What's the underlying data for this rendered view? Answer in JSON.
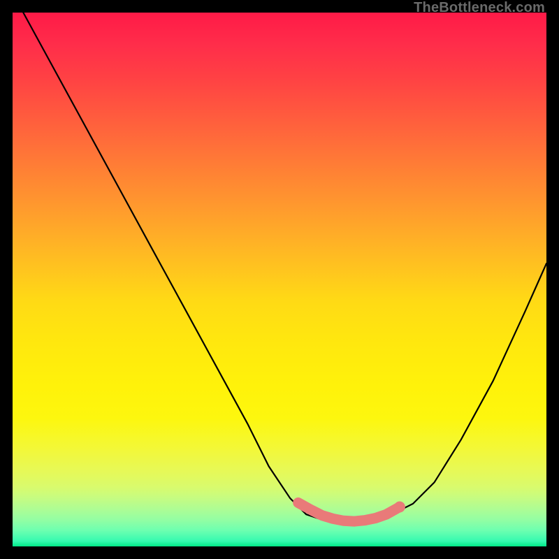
{
  "watermark": "TheBottleneck.com",
  "chart_data": {
    "type": "line",
    "title": "",
    "xlabel": "",
    "ylabel": "",
    "xlim": [
      0,
      100
    ],
    "ylim": [
      0,
      100
    ],
    "series": [
      {
        "name": "bottleneck-curve",
        "x": [
          2,
          8,
          14,
          20,
          26,
          32,
          38,
          44,
          48,
          52,
          55,
          58,
          62,
          65,
          68,
          71,
          75,
          79,
          84,
          90,
          96,
          100
        ],
        "y": [
          100,
          89,
          78,
          67,
          56,
          45,
          34,
          23,
          15,
          9,
          6,
          5,
          4.5,
          4.5,
          5,
          6,
          8,
          12,
          20,
          31,
          44,
          53
        ]
      }
    ],
    "highlight": {
      "name": "trough-region",
      "x": [
        53.5,
        56,
        58,
        60,
        62,
        64,
        66,
        68,
        70,
        72.5
      ],
      "y": [
        8.2,
        6.8,
        5.8,
        5.2,
        4.8,
        4.7,
        4.9,
        5.3,
        6.0,
        7.4
      ]
    },
    "marker": {
      "x": 72.5,
      "y": 7.4
    }
  }
}
